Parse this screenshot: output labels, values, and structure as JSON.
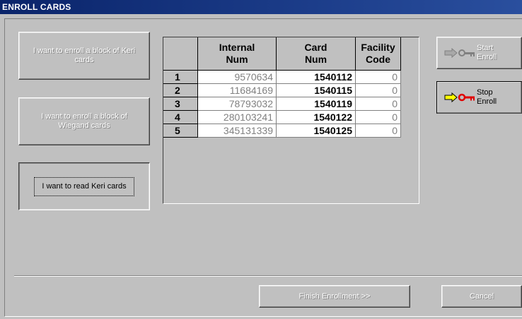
{
  "window": {
    "title": "ENROLL CARDS"
  },
  "left_buttons": {
    "enroll_keri": "I want to enroll a block of Keri cards",
    "enroll_wiegand": "I want to enroll a block of Wiegand cards",
    "read_keri": "I want to read Keri cards"
  },
  "table": {
    "columns": [
      "",
      "Internal Num",
      "Card Num",
      "Facility Code"
    ],
    "rows": [
      {
        "index": "1",
        "internal": "9570634",
        "card": "1540112",
        "facility": "0"
      },
      {
        "index": "2",
        "internal": "11684169",
        "card": "1540115",
        "facility": "0"
      },
      {
        "index": "3",
        "internal": "78793032",
        "card": "1540119",
        "facility": "0"
      },
      {
        "index": "4",
        "internal": "280103241",
        "card": "1540122",
        "facility": "0"
      },
      {
        "index": "5",
        "internal": "345131339",
        "card": "1540125",
        "facility": "0"
      }
    ]
  },
  "right_buttons": {
    "start": "Start Enroll",
    "stop": "Stop Enroll",
    "start_icon": "gray-arrow-key-icon",
    "stop_icon": "yellow-arrow-red-key-icon"
  },
  "footer": {
    "finish": "Finish Enrollment >>",
    "cancel": "Cancel"
  },
  "colors": {
    "titlebar": "#0a246a",
    "face": "#c0c0c0",
    "arrow": "#ffff00",
    "key": "#e00000"
  }
}
